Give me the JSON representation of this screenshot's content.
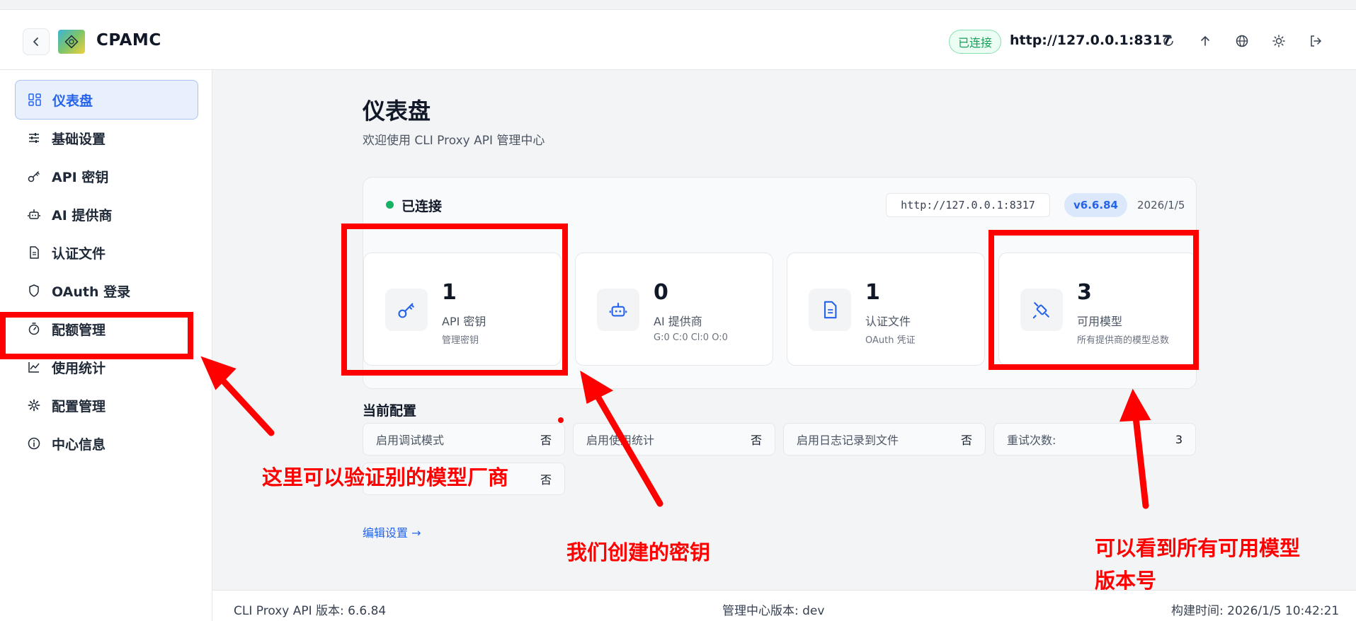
{
  "header": {
    "brand": "CPAMC",
    "connection_status": "已连接",
    "server_url": "http://127.0.0.1:8317"
  },
  "sidebar": {
    "items": [
      {
        "label": "仪表盘",
        "icon": "dashboard-icon",
        "active": true
      },
      {
        "label": "基础设置",
        "icon": "sliders-icon"
      },
      {
        "label": "API 密钥",
        "icon": "key-icon"
      },
      {
        "label": "AI 提供商",
        "icon": "robot-icon"
      },
      {
        "label": "认证文件",
        "icon": "file-icon"
      },
      {
        "label": "OAuth 登录",
        "icon": "shield-icon"
      },
      {
        "label": "配额管理",
        "icon": "timer-icon"
      },
      {
        "label": "使用统计",
        "icon": "chart-icon"
      },
      {
        "label": "配置管理",
        "icon": "gear-icon"
      },
      {
        "label": "中心信息",
        "icon": "info-icon"
      }
    ]
  },
  "main": {
    "title": "仪表盘",
    "subtitle": "欢迎使用 CLI Proxy API 管理中心",
    "status": {
      "label": "已连接",
      "url": "http://127.0.0.1:8317",
      "version": "v6.6.84",
      "date": "2026/1/5"
    },
    "stats": [
      {
        "value": "1",
        "label": "API 密钥",
        "sub": "管理密钥",
        "icon": "key-icon"
      },
      {
        "value": "0",
        "label": "AI 提供商",
        "sub": "G:0 C:0 Cl:0 O:0",
        "icon": "robot-icon"
      },
      {
        "value": "1",
        "label": "认证文件",
        "sub": "OAuth 凭证",
        "icon": "file-icon"
      },
      {
        "value": "3",
        "label": "可用模型",
        "sub": "所有提供商的模型总数",
        "icon": "satellite-icon"
      }
    ],
    "config_title": "当前配置",
    "config": [
      {
        "label": "启用调试模式",
        "value": "否"
      },
      {
        "label": "启用使用统计",
        "value": "否"
      },
      {
        "label": "启用日志记录到文件",
        "value": "否"
      },
      {
        "label": "重试次数:",
        "value": "3"
      },
      {
        "label": "",
        "value": "否"
      }
    ],
    "edit_link": "编辑设置 →"
  },
  "footer": {
    "api_version": "CLI Proxy API 版本: 6.6.84",
    "center_version": "管理中心版本: dev",
    "build_time": "构建时间: 2026/1/5 10:42:21"
  },
  "annotations": {
    "oauth_note": "这里可以验证别的模型厂商",
    "key_note": "我们创建的密钥",
    "models_note_line1": "可以看到所有可用模型",
    "models_note_line2": "版本号",
    "color": "#ff0000"
  }
}
